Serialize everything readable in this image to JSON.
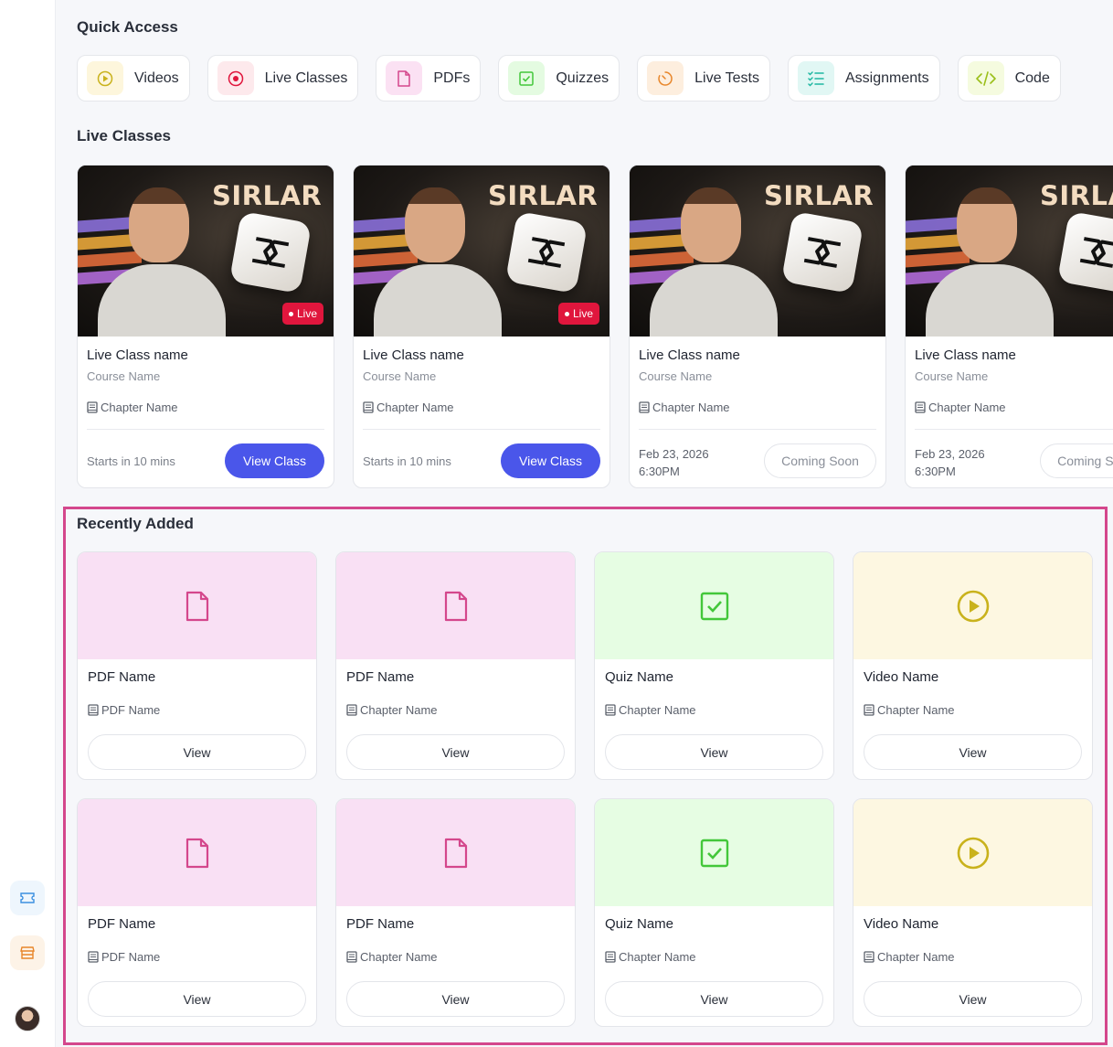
{
  "colors": {
    "accent": "#4a56ea",
    "live_badge": "#e0163d",
    "highlight": "#d4478c",
    "pdf_bg": "#f9e0f4",
    "quiz_bg": "#e6fde3",
    "video_bg": "#fdf7e1"
  },
  "sidebar": {
    "icons": [
      "ticket-icon",
      "store-icon"
    ],
    "avatar": "user-avatar"
  },
  "quick_access": {
    "title": "Quick Access",
    "items": [
      {
        "label": "Videos",
        "icon": "play-circle-icon",
        "bg": "#fdf6dc",
        "color": "#c9b21c"
      },
      {
        "label": "Live Classes",
        "icon": "record-icon",
        "bg": "#fde9ec",
        "color": "#e0163d"
      },
      {
        "label": "PDFs",
        "icon": "file-icon",
        "bg": "#fbe1f3",
        "color": "#d4478c"
      },
      {
        "label": "Quizzes",
        "icon": "checkbox-icon",
        "bg": "#e4fbe1",
        "color": "#43c73a"
      },
      {
        "label": "Live Tests",
        "icon": "timer-icon",
        "bg": "#fdeede",
        "color": "#e8862a"
      },
      {
        "label": "Assignments",
        "icon": "checklist-icon",
        "bg": "#e1f7f4",
        "color": "#1fb7a2"
      },
      {
        "label": "Code",
        "icon": "code-icon",
        "bg": "#f5fbdf",
        "color": "#9bbf1a"
      }
    ]
  },
  "live_classes": {
    "title": "Live Classes",
    "brand_text": "SIRLAR",
    "cards": [
      {
        "name": "Live Class name",
        "course": "Course Name",
        "chapter": "Chapter Name",
        "live_badge": "Live",
        "status": "Starts in 10 mins",
        "button": "View Class"
      },
      {
        "name": "Live Class name",
        "course": "Course Name",
        "chapter": "Chapter Name",
        "live_badge": "Live",
        "status": "Starts in 10 mins",
        "button": "View Class"
      },
      {
        "name": "Live Class name",
        "course": "Course Name",
        "chapter": "Chapter Name",
        "date": "Feb 23, 2026",
        "time": "6:30PM",
        "button": "Coming Soon"
      },
      {
        "name": "Live Class name",
        "course": "Course Name",
        "chapter": "Chapter Name",
        "date": "Feb 23, 2026",
        "time": "6:30PM",
        "button": "Coming Soon"
      }
    ]
  },
  "recently_added": {
    "title": "Recently Added",
    "items": [
      {
        "type": "pdf",
        "name": "PDF Name",
        "chapter": "PDF Name",
        "button": "View"
      },
      {
        "type": "pdf",
        "name": "PDF Name",
        "chapter": "Chapter Name",
        "button": "View"
      },
      {
        "type": "quiz",
        "name": "Quiz Name",
        "chapter": "Chapter Name",
        "button": "View"
      },
      {
        "type": "video",
        "name": "Video Name",
        "chapter": "Chapter Name",
        "button": "View"
      },
      {
        "type": "pdf",
        "name": "PDF Name",
        "chapter": "PDF Name",
        "button": "View"
      },
      {
        "type": "pdf",
        "name": "PDF Name",
        "chapter": "Chapter Name",
        "button": "View"
      },
      {
        "type": "quiz",
        "name": "Quiz Name",
        "chapter": "Chapter Name",
        "button": "View"
      },
      {
        "type": "video",
        "name": "Video Name",
        "chapter": "Chapter Name",
        "button": "View"
      }
    ]
  }
}
